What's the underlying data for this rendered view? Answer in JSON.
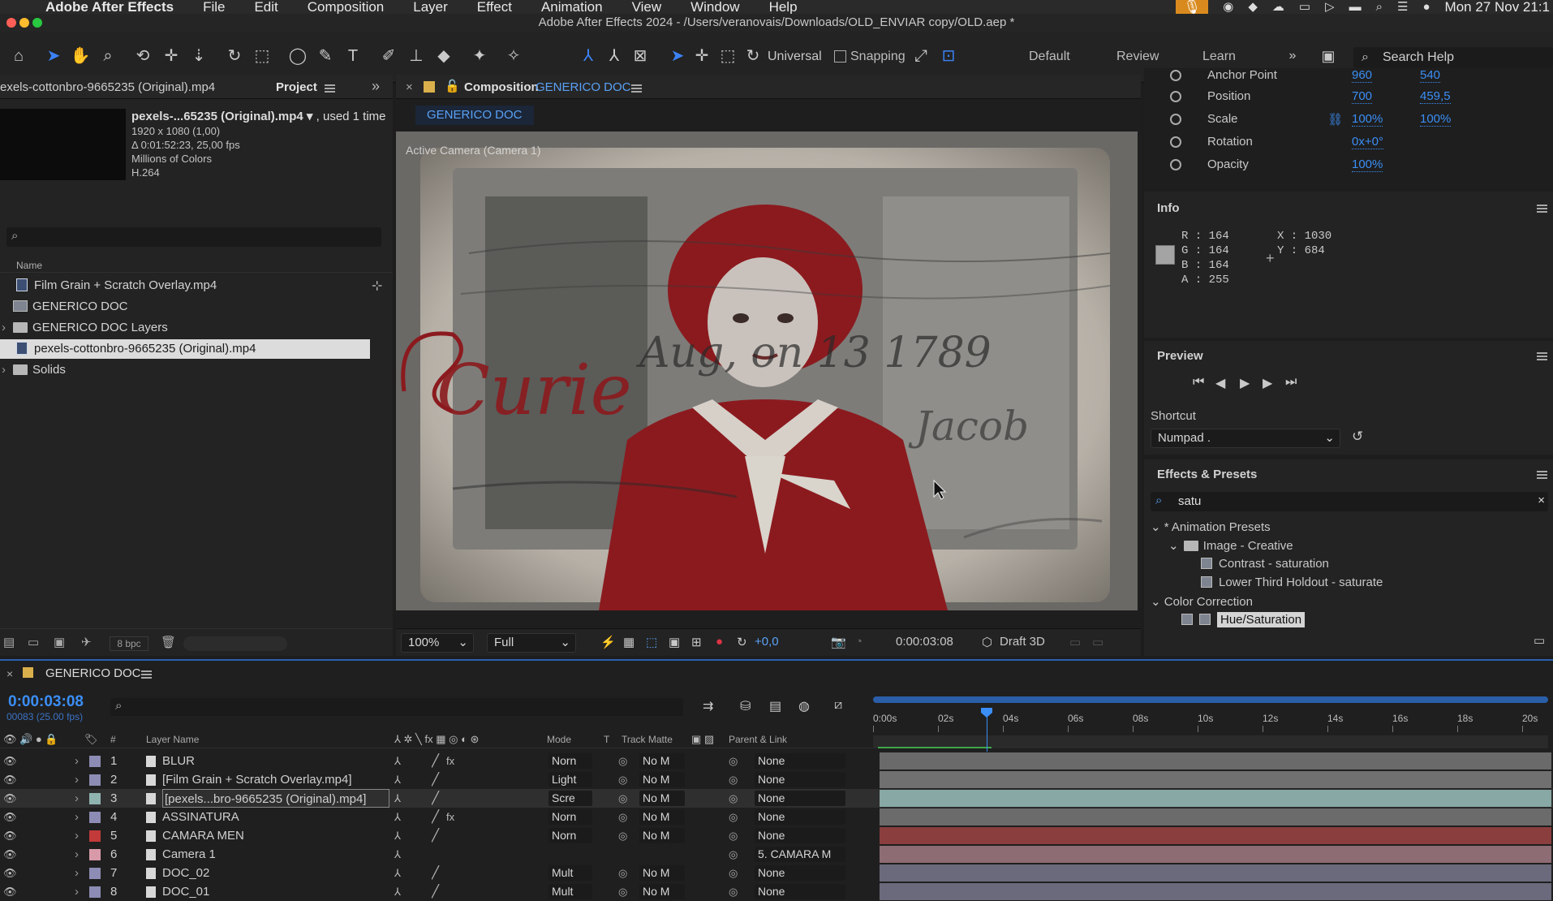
{
  "menubar": {
    "app": "Adobe After Effects",
    "items": [
      "File",
      "Edit",
      "Composition",
      "Layer",
      "Effect",
      "Animation",
      "View",
      "Window",
      "Help"
    ],
    "clock": "Mon 27 Nov  21:1"
  },
  "window_title": "Adobe After Effects 2024 - /Users/veranovais/Downloads/OLD_ENVIAR copy/OLD.aep *",
  "toolbar": {
    "universal_label": "Universal",
    "snapping_label": "Snapping",
    "workspaces": [
      "Default",
      "Review",
      "Learn"
    ],
    "search_help_placeholder": "Search Help"
  },
  "project": {
    "source_name_tab": "exels-cottonbro-9665235 (Original).mp4",
    "tab_label": "Project",
    "item_title": "pexels-...65235 (Original).mp4",
    "used_text": ", used 1 time",
    "details": [
      "1920 x 1080 (1,00)",
      "Δ 0:01:52:23, 25,00 fps",
      "Millions of Colors",
      "H.264"
    ],
    "column_name": "Name",
    "items": [
      {
        "label": "Film Grain + Scratch Overlay.mp4",
        "type": "file"
      },
      {
        "label": "GENERICO DOC",
        "type": "comp"
      },
      {
        "label": "GENERICO DOC Layers",
        "type": "folder"
      },
      {
        "label": "pexels-cottonbro-9665235 (Original).mp4",
        "type": "file"
      },
      {
        "label": "Solids",
        "type": "folder"
      }
    ],
    "bpc": "8 bpc"
  },
  "composition": {
    "tab_prefix": "Composition",
    "tab_name": "GENERICO DOC",
    "breadcrumb": "GENERICO DOC",
    "camera_label": "Active Camera (Camera 1)",
    "zoom": "100%",
    "resolution": "Full",
    "exposure": "+0,0",
    "timecode": "0:00:03:08",
    "renderer": "Draft 3D",
    "handwriting": [
      "Curie",
      "Aug, on 13 1789",
      "Jacob"
    ]
  },
  "transform": {
    "anchor_label": "Anchor Point",
    "anchor_x": "960",
    "anchor_y": "540",
    "position_label": "Position",
    "position_x": "700",
    "position_y": "459,5",
    "scale_label": "Scale",
    "scale_x": "100%",
    "scale_y": "100%",
    "rotation_label": "Rotation",
    "rotation": "0x+0°",
    "opacity_label": "Opacity",
    "opacity": "100%"
  },
  "info": {
    "title": "Info",
    "r": "R : 164",
    "g": "G : 164",
    "b": "B : 164",
    "a": "A : 255",
    "x": "X : 1030",
    "y": "Y : 684",
    "swatch_color": "#a4a4a4"
  },
  "preview": {
    "title": "Preview",
    "shortcut_label": "Shortcut",
    "shortcut_value": "Numpad ."
  },
  "effects": {
    "title": "Effects & Presets",
    "search_value": "satu",
    "tree": [
      {
        "label": "* Animation Presets",
        "level": 0,
        "kind": "group"
      },
      {
        "label": "Image - Creative",
        "level": 1,
        "kind": "folder"
      },
      {
        "label": "Contrast - saturation",
        "level": 2,
        "kind": "preset"
      },
      {
        "label": "Lower Third Holdout - saturate",
        "level": 2,
        "kind": "preset"
      },
      {
        "label": "Color Correction",
        "level": 0,
        "kind": "group"
      },
      {
        "label": "Hue/Saturation",
        "level": 2,
        "kind": "effect"
      }
    ]
  },
  "timeline": {
    "comp_name": "GENERICO DOC",
    "timecode": "0:00:03:08",
    "frame_info": "00083 (25.00 fps)",
    "headers": {
      "label": "#",
      "layer_name": "Layer Name",
      "mode": "Mode",
      "t": "T",
      "track_matte": "Track Matte",
      "parent": "Parent & Link"
    },
    "ruler": [
      "0:00s",
      "02s",
      "04s",
      "06s",
      "08s",
      "10s",
      "12s",
      "14s",
      "16s",
      "18s",
      "20s"
    ],
    "layers": [
      {
        "num": "1",
        "name": "BLUR",
        "color": "#8c8cb4",
        "mode": "Norn",
        "matte": "No M",
        "parent": "None",
        "bar": "#6a6a6a",
        "fx": true
      },
      {
        "num": "2",
        "name": "[Film Grain + Scratch Overlay.mp4]",
        "color": "#8c8cb4",
        "mode": "Light",
        "matte": "No M",
        "parent": "None",
        "bar": "#707070",
        "fx": false
      },
      {
        "num": "3",
        "name": "[pexels...bro-9665235 (Original).mp4]",
        "color": "#8fb4b0",
        "mode": "Scre",
        "matte": "No M",
        "parent": "None",
        "bar": "#87a8a4",
        "fx": false
      },
      {
        "num": "4",
        "name": "ASSINATURA",
        "color": "#8c8cb4",
        "mode": "Norn",
        "matte": "No M",
        "parent": "None",
        "bar": "#6b6b6b",
        "fx": true
      },
      {
        "num": "5",
        "name": "CAMARA MEN",
        "color": "#c23a3a",
        "mode": "Norn",
        "matte": "No M",
        "parent": "None",
        "bar": "#8a3e3e",
        "fx": false
      },
      {
        "num": "6",
        "name": "Camera 1",
        "color": "#d89aa8",
        "mode": "",
        "matte": "",
        "parent": "5. CAMARA M",
        "bar": "#8e6c74",
        "fx": false
      },
      {
        "num": "7",
        "name": "DOC_02",
        "color": "#8c8cb4",
        "mode": "Mult",
        "matte": "No M",
        "parent": "None",
        "bar": "#6a6a7c",
        "fx": false
      },
      {
        "num": "8",
        "name": "DOC_01",
        "color": "#8c8cb4",
        "mode": "Mult",
        "matte": "No M",
        "parent": "None",
        "bar": "#6a6a7c",
        "fx": false
      }
    ]
  }
}
